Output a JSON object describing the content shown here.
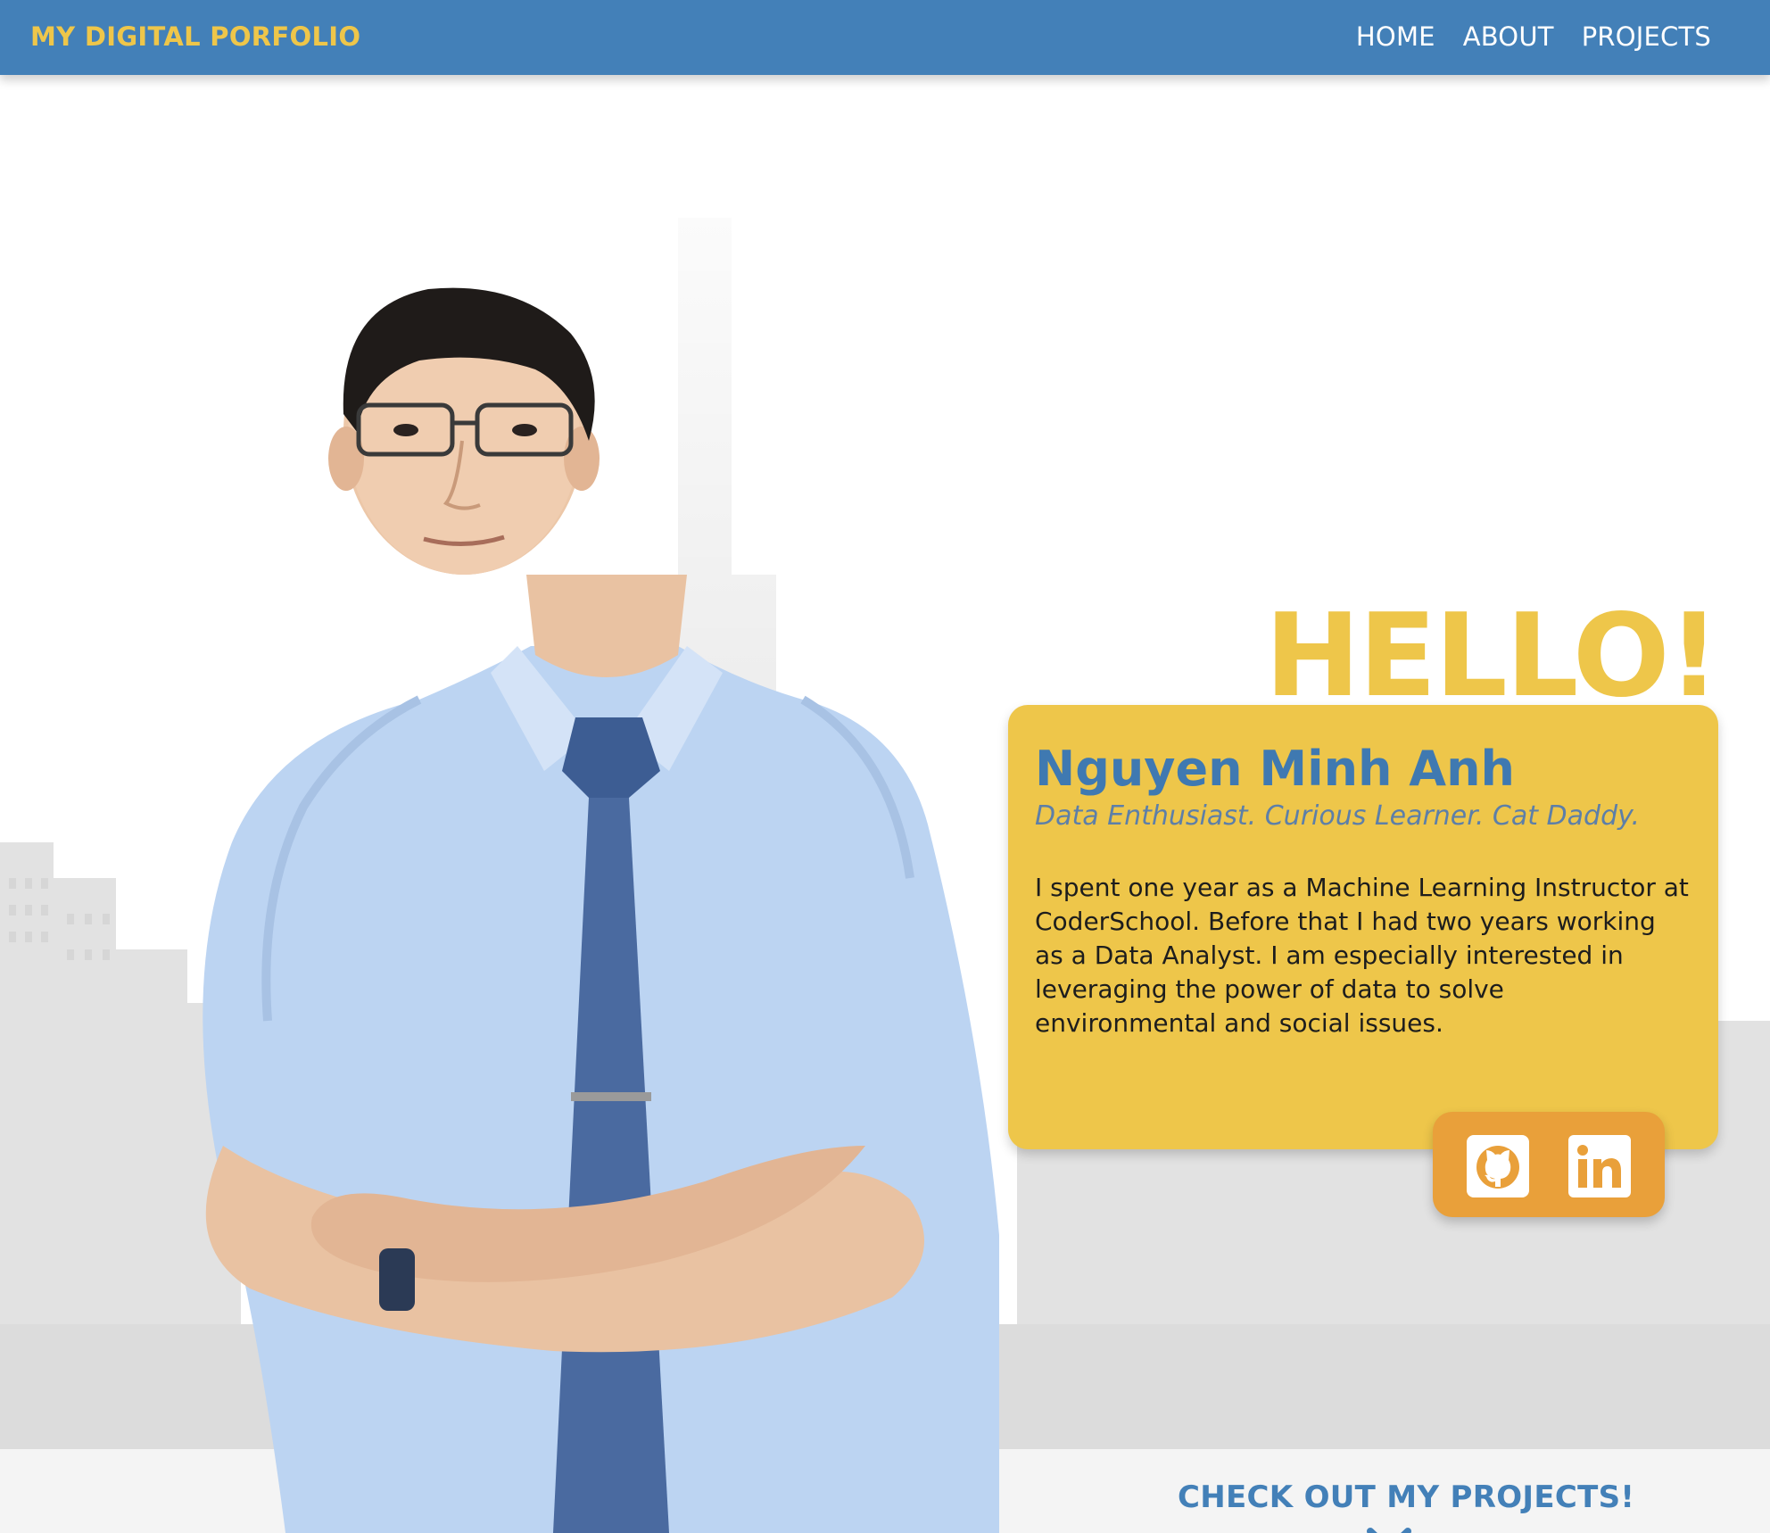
{
  "navbar": {
    "brand": "MY DIGITAL PORFOLIO",
    "links": [
      "HOME",
      "ABOUT",
      "PROJECTS"
    ]
  },
  "hero": {
    "greeting": "HELLO!",
    "name": "Nguyen Minh Anh",
    "tagline": "Data Enthusiast. Curious Learner. Cat Daddy.",
    "bio": "I spent one year as a Machine Learning Instructor at CoderSchool. Before that I had two years working as a Data Analyst. I am especially interested in leveraging the power of data to solve environmental and social issues.",
    "social": [
      {
        "icon": "github-icon"
      },
      {
        "icon": "linkedin-icon"
      }
    ],
    "cta": "CHECK OUT MY PROJECTS!"
  },
  "colors": {
    "navbar": "#4380b8",
    "accent_yellow": "#eec64a",
    "accent_orange": "#e9a03a",
    "name_blue": "#3f79b1",
    "cta_blue": "#4380b8"
  }
}
